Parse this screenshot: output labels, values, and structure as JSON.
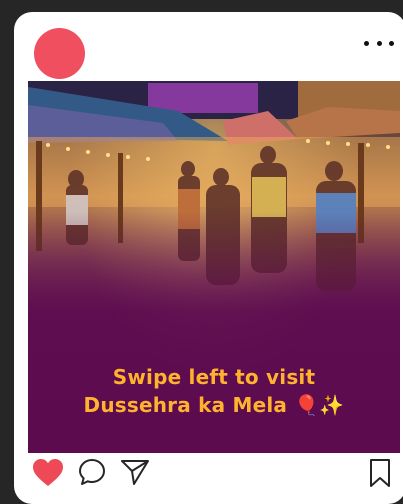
{
  "post": {
    "caption_line1": "Swipe left to visit",
    "caption_line2": "Dussehra ka Mela 🎈✨"
  },
  "icons": {
    "avatar": "avatar",
    "more": "more-options-icon",
    "like": "heart-icon",
    "comment": "comment-icon",
    "share": "send-icon",
    "save": "bookmark-icon"
  },
  "colors": {
    "background": "#262626",
    "card": "#ffffff",
    "avatar": "#ef4f5f",
    "like": "#ed4956",
    "caption": "#ffb22e",
    "overlay": "#5c0b4f"
  }
}
